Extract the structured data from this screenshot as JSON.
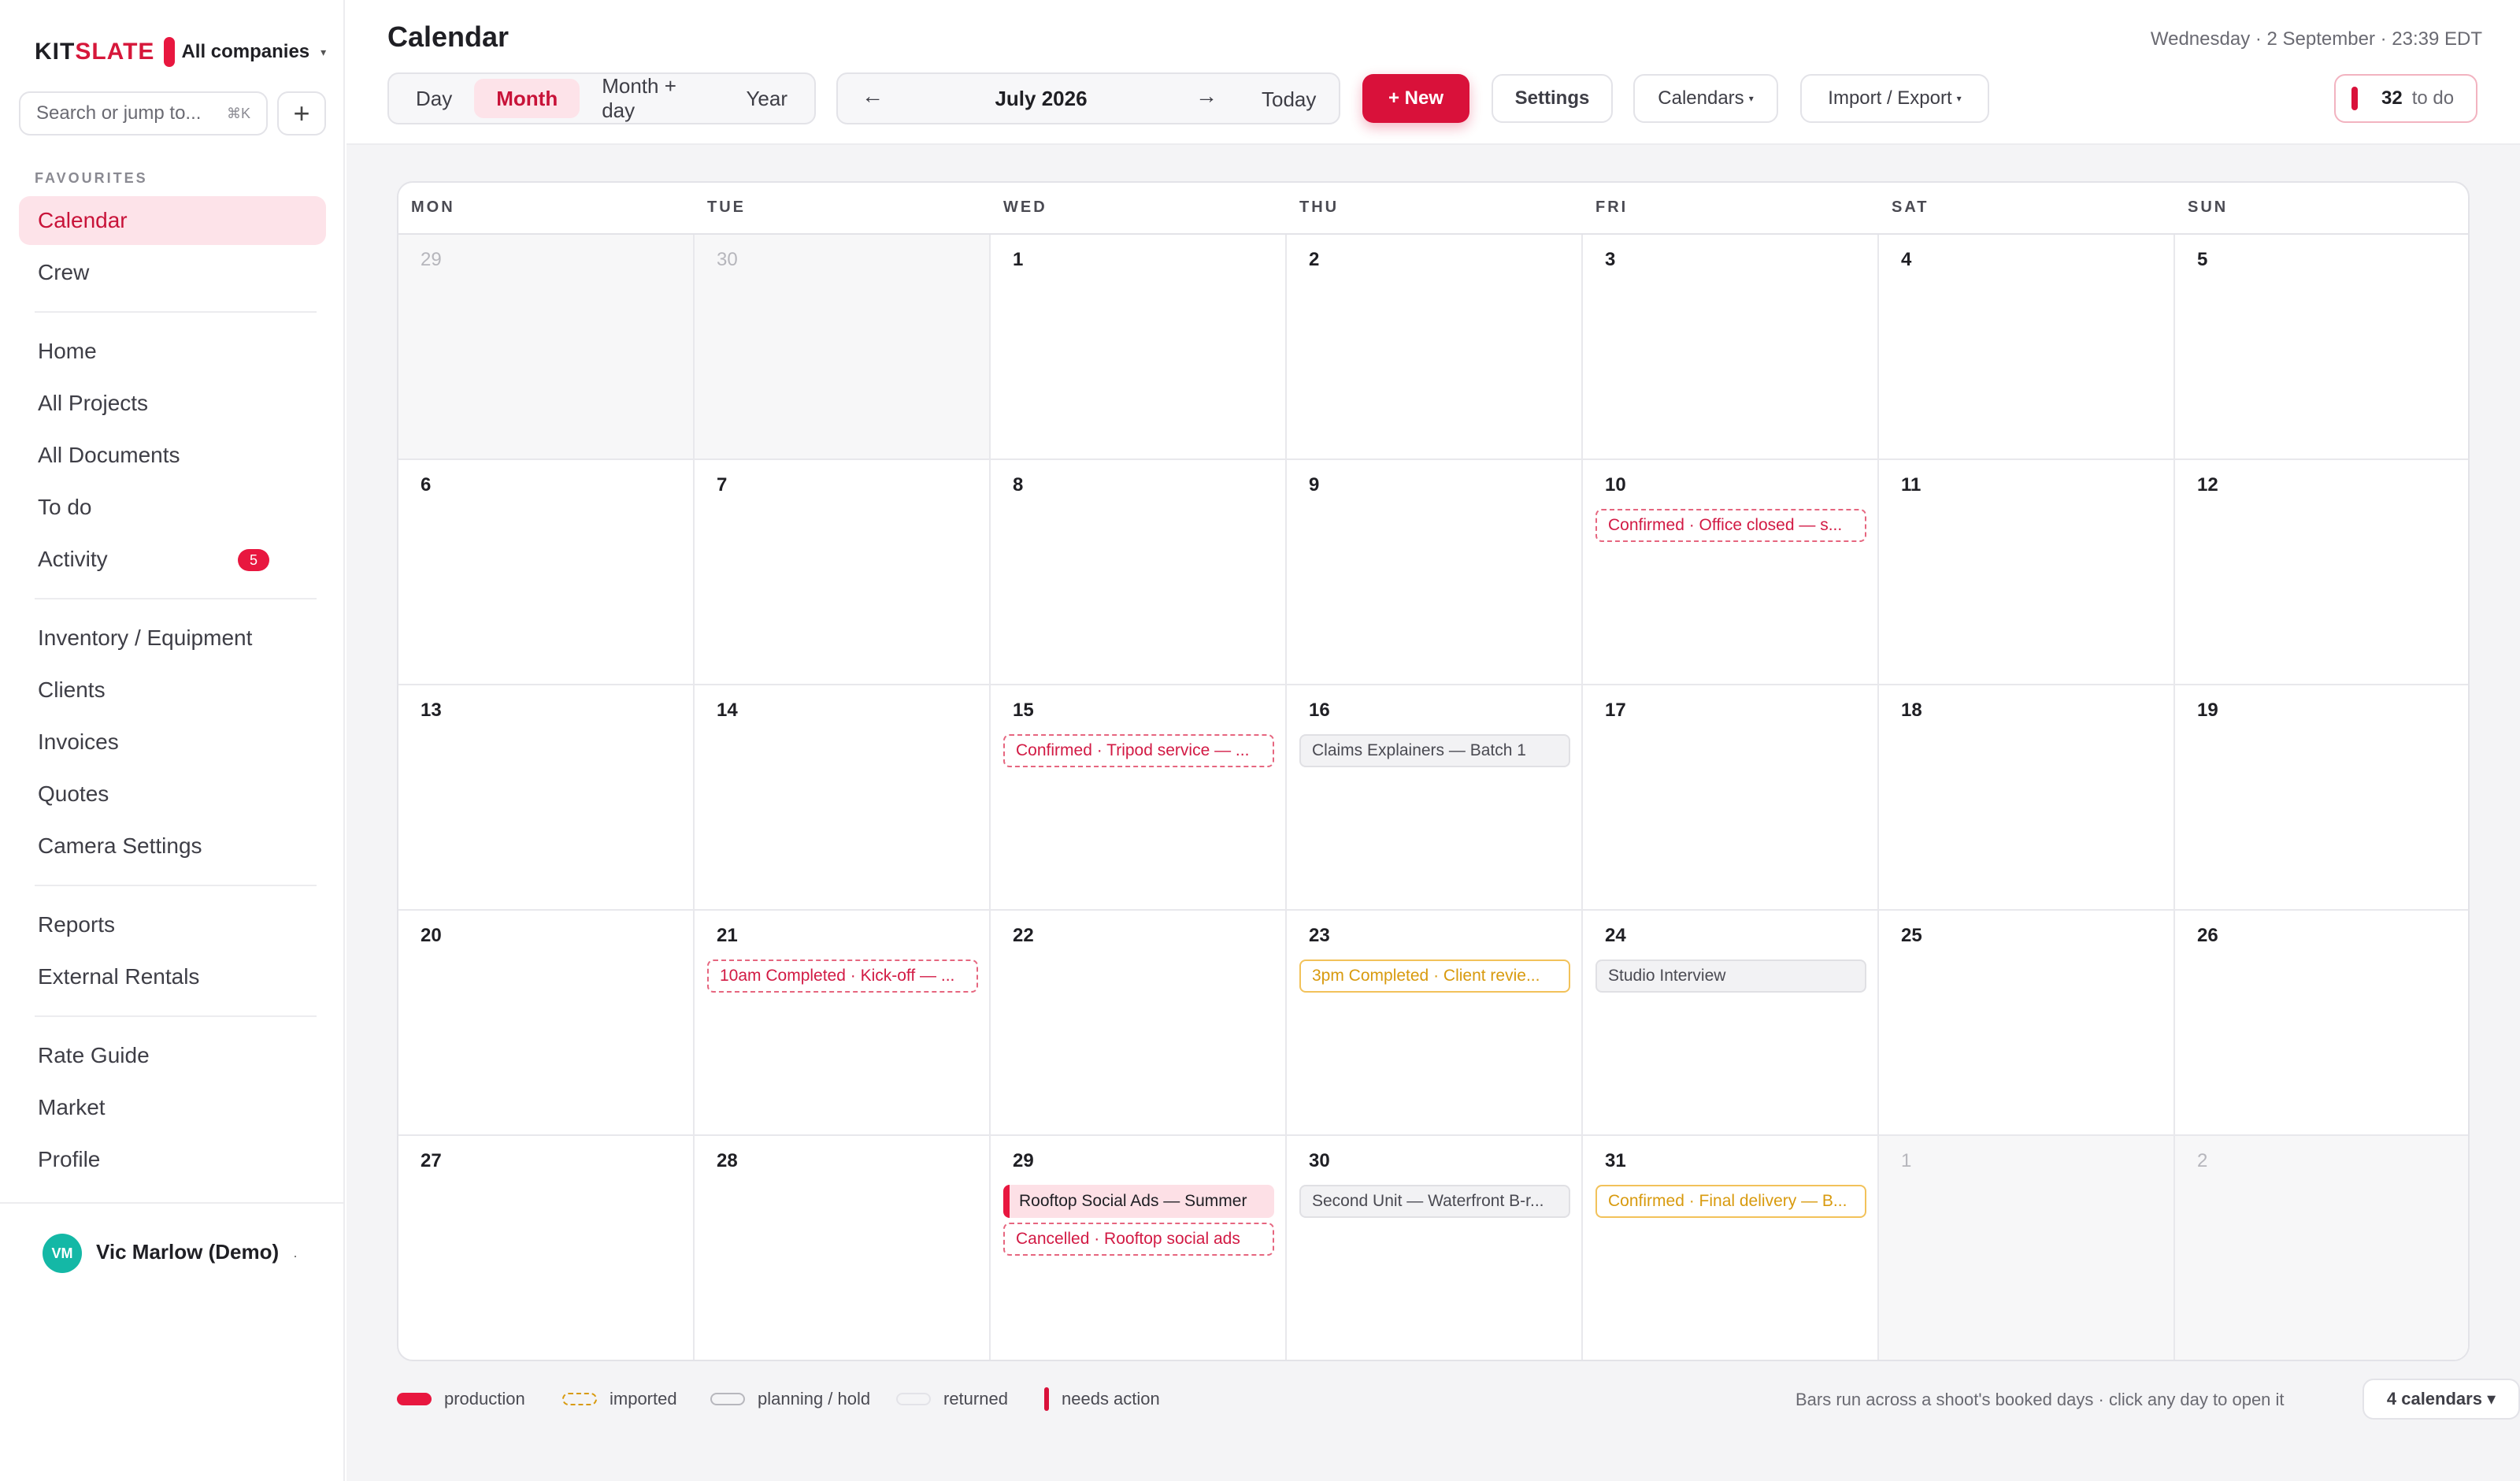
{
  "brand": {
    "logo_a": "KIT",
    "logo_b": "SLATE",
    "company": "All companies",
    "caret": "▾"
  },
  "search": {
    "placeholder": "Search or jump to...",
    "shortcut": "⌘K",
    "add": "+"
  },
  "sidebar": {
    "section_label": "FAVOURITES",
    "items": [
      {
        "label": "Calendar",
        "active": true
      },
      {
        "label": "Crew"
      },
      {
        "label": "Home"
      },
      {
        "label": "All Projects"
      },
      {
        "label": "All Documents"
      },
      {
        "label": "To do"
      },
      {
        "label": "Activity",
        "badge": "5"
      },
      {
        "label": "Inventory / Equipment"
      },
      {
        "label": "Clients"
      },
      {
        "label": "Invoices"
      },
      {
        "label": "Quotes"
      },
      {
        "label": "Camera Settings"
      },
      {
        "label": "Reports"
      },
      {
        "label": "External Rentals"
      },
      {
        "label": "Rate Guide"
      },
      {
        "label": "Market"
      },
      {
        "label": "Profile"
      }
    ],
    "user": {
      "initials": "VM",
      "name": "Vic Marlow (Demo)",
      "menu": "·"
    }
  },
  "header": {
    "title": "Calendar",
    "datetime": "Wednesday · 2 September · 23:39 EDT",
    "views": [
      "Day",
      "Month",
      "Month + day",
      "Year"
    ],
    "active_view": "Month",
    "prev_arrow": "←",
    "next_arrow": "→",
    "current_period": "July 2026",
    "today": "Today",
    "new": "+ New",
    "settings": "Settings",
    "calendars": "Calendars",
    "import_export": "Import / Export",
    "caret": "▾",
    "todo_count": "32",
    "todo_label": "to do"
  },
  "calendar": {
    "weekdays": [
      "MON",
      "TUE",
      "WED",
      "THU",
      "FRI",
      "SAT",
      "SUN"
    ],
    "weeks": [
      [
        {
          "d": "29",
          "out": true
        },
        {
          "d": "30",
          "out": true
        },
        {
          "d": "1"
        },
        {
          "d": "2"
        },
        {
          "d": "3"
        },
        {
          "d": "4"
        },
        {
          "d": "5"
        }
      ],
      [
        {
          "d": "6"
        },
        {
          "d": "7"
        },
        {
          "d": "8"
        },
        {
          "d": "9"
        },
        {
          "d": "10",
          "events": [
            {
              "text": "Confirmed · Office closed — s...",
              "style": "red-dash"
            }
          ]
        },
        {
          "d": "11"
        },
        {
          "d": "12"
        }
      ],
      [
        {
          "d": "13"
        },
        {
          "d": "14"
        },
        {
          "d": "15",
          "events": [
            {
              "text": "Confirmed · Tripod service — ...",
              "style": "red-dash"
            }
          ]
        },
        {
          "d": "16",
          "events": [
            {
              "text": "Claims Explainers — Batch 1",
              "style": "gray"
            }
          ]
        },
        {
          "d": "17"
        },
        {
          "d": "18"
        },
        {
          "d": "19"
        }
      ],
      [
        {
          "d": "20"
        },
        {
          "d": "21",
          "events": [
            {
              "text": "10am Completed · Kick-off — ...",
              "style": "red-dash"
            }
          ]
        },
        {
          "d": "22"
        },
        {
          "d": "23",
          "events": [
            {
              "text": "3pm Completed · Client revie...",
              "style": "yellow-solid"
            }
          ]
        },
        {
          "d": "24",
          "events": [
            {
              "text": "Studio Interview",
              "style": "gray"
            }
          ]
        },
        {
          "d": "25"
        },
        {
          "d": "26"
        }
      ],
      [
        {
          "d": "27"
        },
        {
          "d": "28"
        },
        {
          "d": "29",
          "events": [
            {
              "text": "Rooftop Social Ads — Summer",
              "style": "pink-solid"
            },
            {
              "text": "Cancelled · Rooftop social ads",
              "style": "red-dash"
            }
          ]
        },
        {
          "d": "30",
          "events": [
            {
              "text": "Second Unit — Waterfront B-r...",
              "style": "gray"
            }
          ]
        },
        {
          "d": "31",
          "events": [
            {
              "text": "Confirmed · Final delivery — B...",
              "style": "yellow-solid"
            }
          ]
        },
        {
          "d": "1",
          "out": true
        },
        {
          "d": "2",
          "out": true
        }
      ]
    ]
  },
  "legend": {
    "production": "production",
    "imported": "imported",
    "planning": "planning / hold",
    "returned": "returned",
    "needs_action": "needs action",
    "hint": "Bars run across a shoot's booked days · click any day to open it",
    "calendars_count": "4 calendars ▾"
  },
  "colors": {
    "accent": "#d9113a",
    "accent_soft": "#fde3e9",
    "imported": "#d89a0e",
    "neutral": "#f2f2f4"
  }
}
